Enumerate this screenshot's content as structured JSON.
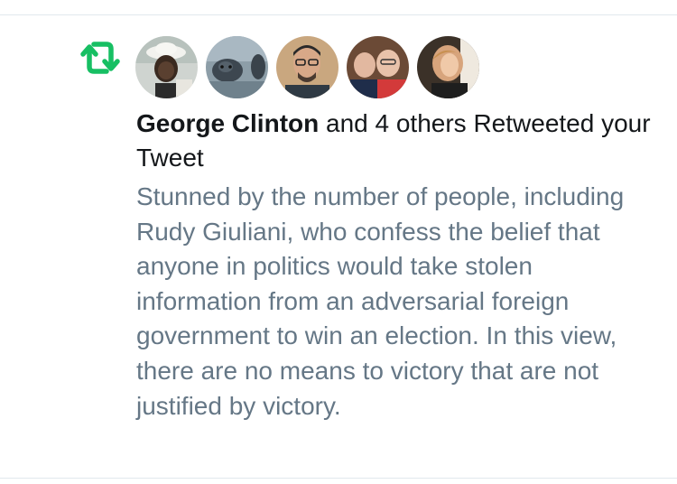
{
  "notification": {
    "type_icon": "retweet-icon",
    "accent_color": "#17bf63",
    "actor_name": "George Clinton",
    "action_text": " and 4 others Retweeted your Tweet",
    "avatars": [
      {
        "name": "avatar-1"
      },
      {
        "name": "avatar-2"
      },
      {
        "name": "avatar-3"
      },
      {
        "name": "avatar-4"
      },
      {
        "name": "avatar-5"
      }
    ]
  },
  "tweet": {
    "text": "Stunned by the number of people, including Rudy Giuliani, who confess the belief that anyone in politics would take stolen information from an adversarial foreign government to win an election. In this view, there are no means to victory that are not justified by victory."
  },
  "colors": {
    "primary_text": "#14171a",
    "secondary_text": "#657786",
    "divider": "#e1e8ed"
  }
}
